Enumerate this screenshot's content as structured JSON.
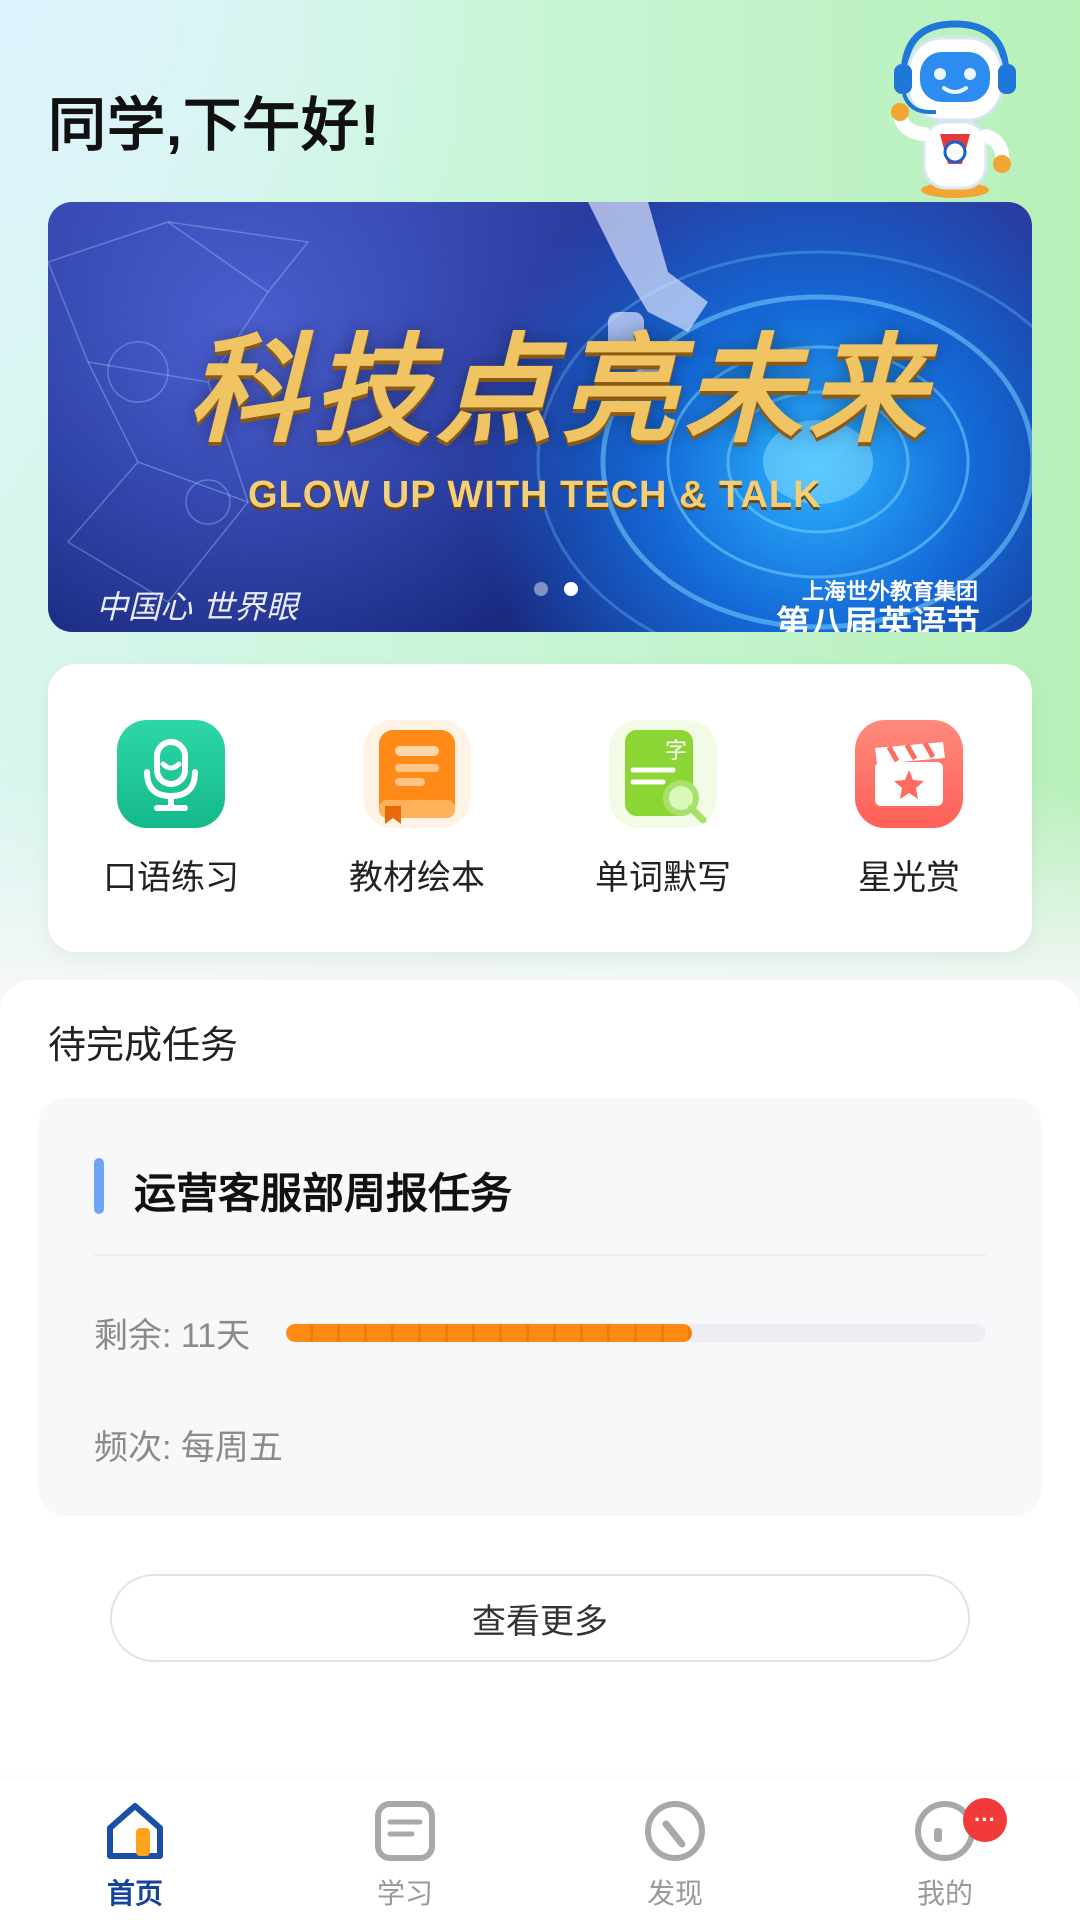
{
  "header": {
    "greeting": "同学,下午好!"
  },
  "banner": {
    "title": "科技点亮未来",
    "subtitle": "GLOW UP WITH TECH & TALK",
    "organizer": "上海世外教育集团",
    "festival": "第八届英语节",
    "logo_text": "中国心 世界眼",
    "slide_count": 2,
    "active_slide": 2
  },
  "features": [
    {
      "label": "口语练习",
      "icon": "microphone-icon",
      "color": "#1ec79a"
    },
    {
      "label": "教材绘本",
      "icon": "book-icon",
      "color": "#ff8a18"
    },
    {
      "label": "单词默写",
      "icon": "word-notebook-icon",
      "color": "#8bd534"
    },
    {
      "label": "星光赏",
      "icon": "clapperboard-star-icon",
      "color": "#ff6b5e"
    }
  ],
  "tasks": {
    "section_title": "待完成任务",
    "items": [
      {
        "name": "运营客服部周报任务",
        "remaining": "剩余: 11天",
        "progress_fraction": 0.58,
        "frequency": "频次: 每周五",
        "accent_color": "#6ea3f7",
        "progress_color": "#ff8a14"
      }
    ],
    "more_label": "查看更多"
  },
  "nav": {
    "items": [
      {
        "label": "首页",
        "icon": "home-icon",
        "active": true
      },
      {
        "label": "学习",
        "icon": "study-icon",
        "active": false
      },
      {
        "label": "发现",
        "icon": "discover-icon",
        "active": false
      },
      {
        "label": "我的",
        "icon": "profile-icon",
        "active": false,
        "badge": "···"
      }
    ]
  }
}
